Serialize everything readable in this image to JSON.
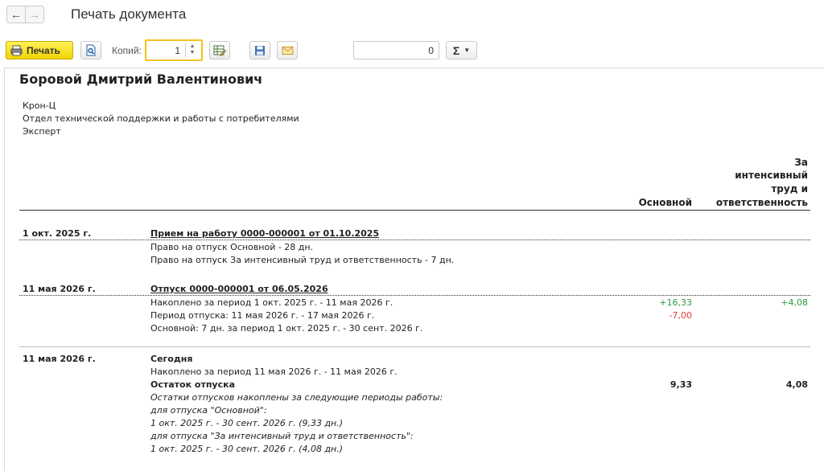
{
  "window": {
    "title": "Печать документа"
  },
  "toolbar": {
    "print_label": "Печать",
    "copies_label": "Копий:",
    "copies_value": "1",
    "sum_value": "0",
    "sum_symbol": "Σ"
  },
  "document": {
    "employee_name": "Боровой Дмитрий Валентинович",
    "organization": "Крон-Ц",
    "department": "Отдел технической поддержки и работы с потребителями",
    "position": "Эксперт",
    "columns": {
      "basic": "Основной",
      "intensive_lines": [
        "За",
        "интенсивный",
        "труд и",
        "ответственность"
      ]
    },
    "sections": [
      {
        "date": "1 окт. 2025 г.",
        "title": "Прием на работу 0000-000001 от 01.10.2025",
        "lines": [
          "Право на отпуск Основной - 28 дн.",
          "Право на отпуск За интенсивный труд и ответственность - 7 дн."
        ]
      },
      {
        "date": "11 мая 2026 г.",
        "title": "Отпуск 0000-000001 от 06.05.2026",
        "lines": [
          "Накоплено за период 1 окт. 2025 г. - 11 мая 2026 г.",
          "Период отпуска: 11 мая 2026 г. - 17 мая 2026 г.",
          "Основной: 7 дн. за период 1 окт. 2025 г. - 30 сент. 2026 г."
        ],
        "values": {
          "accrued_basic": "+16,33",
          "accrued_intensive": "+4,08",
          "used_basic": "-7,00"
        }
      },
      {
        "date": "11 мая 2026 г.",
        "title": "Сегодня",
        "lines": [
          "Накоплено за период 11 мая 2026 г. - 11 мая 2026 г."
        ],
        "balance_label": "Остаток отпуска",
        "balance_basic": "9,33",
        "balance_intensive": "4,08",
        "notes": [
          "Остатки отпусков накоплены за следующие периоды работы:",
          "для отпуска \"Основной\":",
          "1 окт. 2025 г. - 30 сент. 2026 г. (9,33 дн.)",
          "для отпуска \"За интенсивный труд и ответственность\":",
          "1 окт. 2025 г. - 30 сент. 2026 г. (4,08 дн.)"
        ]
      }
    ]
  },
  "colors": {
    "accent_yellow": "#f2d400",
    "positive": "#2e9b3f",
    "negative": "#e23c3c"
  }
}
